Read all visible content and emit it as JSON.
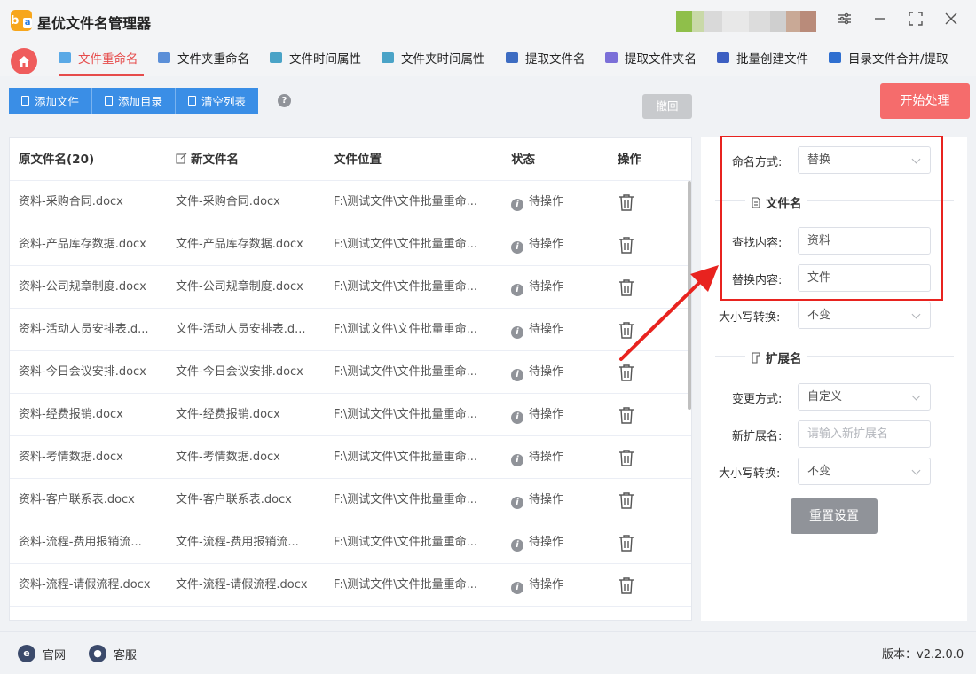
{
  "app": {
    "title": "星优文件名管理器",
    "logo_letter": "b",
    "logo_sub": "a"
  },
  "tabs": [
    {
      "label": "文件重命名",
      "color": "#5aa9e6"
    },
    {
      "label": "文件夹重命名",
      "color": "#5b8fd8"
    },
    {
      "label": "文件时间属性",
      "color": "#4aa3c7"
    },
    {
      "label": "文件夹时间属性",
      "color": "#4aa3c7"
    },
    {
      "label": "提取文件名",
      "color": "#3d6cc2"
    },
    {
      "label": "提取文件夹名",
      "color": "#7b6fd8"
    },
    {
      "label": "批量创建文件",
      "color": "#3d5fc2"
    },
    {
      "label": "目录文件合并/提取",
      "color": "#2f6fd0"
    }
  ],
  "toolbar": {
    "add_file": "添加文件",
    "add_dir": "添加目录",
    "clear_list": "清空列表",
    "help": "?",
    "undo": "撤回",
    "start": "开始处理"
  },
  "table": {
    "headers": {
      "original": "原文件名(20)",
      "new": "新文件名",
      "location": "文件位置",
      "status": "状态",
      "action": "操作"
    },
    "rows": [
      {
        "original": "资料-采购合同.docx",
        "new": "文件-采购合同.docx",
        "location": "F:\\测试文件\\文件批量重命...",
        "status": "待操作"
      },
      {
        "original": "资料-产品库存数据.docx",
        "new": "文件-产品库存数据.docx",
        "location": "F:\\测试文件\\文件批量重命...",
        "status": "待操作"
      },
      {
        "original": "资料-公司规章制度.docx",
        "new": "文件-公司规章制度.docx",
        "location": "F:\\测试文件\\文件批量重命...",
        "status": "待操作"
      },
      {
        "original": "资料-活动人员安排表.d...",
        "new": "文件-活动人员安排表.d...",
        "location": "F:\\测试文件\\文件批量重命...",
        "status": "待操作"
      },
      {
        "original": "资料-今日会议安排.docx",
        "new": "文件-今日会议安排.docx",
        "location": "F:\\测试文件\\文件批量重命...",
        "status": "待操作"
      },
      {
        "original": "资料-经费报销.docx",
        "new": "文件-经费报销.docx",
        "location": "F:\\测试文件\\文件批量重命...",
        "status": "待操作"
      },
      {
        "original": "资料-考情数据.docx",
        "new": "文件-考情数据.docx",
        "location": "F:\\测试文件\\文件批量重命...",
        "status": "待操作"
      },
      {
        "original": "资料-客户联系表.docx",
        "new": "文件-客户联系表.docx",
        "location": "F:\\测试文件\\文件批量重命...",
        "status": "待操作"
      },
      {
        "original": "资料-流程-费用报销流...",
        "new": "文件-流程-费用报销流...",
        "location": "F:\\测试文件\\文件批量重命...",
        "status": "待操作"
      },
      {
        "original": "资料-流程-请假流程.docx",
        "new": "文件-流程-请假流程.docx",
        "location": "F:\\测试文件\\文件批量重命...",
        "status": "待操作"
      }
    ]
  },
  "panel": {
    "naming_label": "命名方式:",
    "naming_value": "替换",
    "filename_section": "文件名",
    "find_label": "查找内容:",
    "find_value": "资料",
    "replace_label": "替换内容:",
    "replace_value": "文件",
    "case_label": "大小写转换:",
    "case_value": "不变",
    "ext_section": "扩展名",
    "change_label": "变更方式:",
    "change_value": "自定义",
    "new_ext_label": "新扩展名:",
    "new_ext_placeholder": "请输入新扩展名",
    "ext_case_label": "大小写转换:",
    "ext_case_value": "不变",
    "reset": "重置设置"
  },
  "footer": {
    "website": "官网",
    "support": "客服",
    "version": "版本：v2.2.0.0"
  },
  "colors": {
    "accent_red": "#e64b4b",
    "primary_blue": "#3a8ee6",
    "start_red": "#f56c6c",
    "annotation_red": "#e8231f"
  }
}
